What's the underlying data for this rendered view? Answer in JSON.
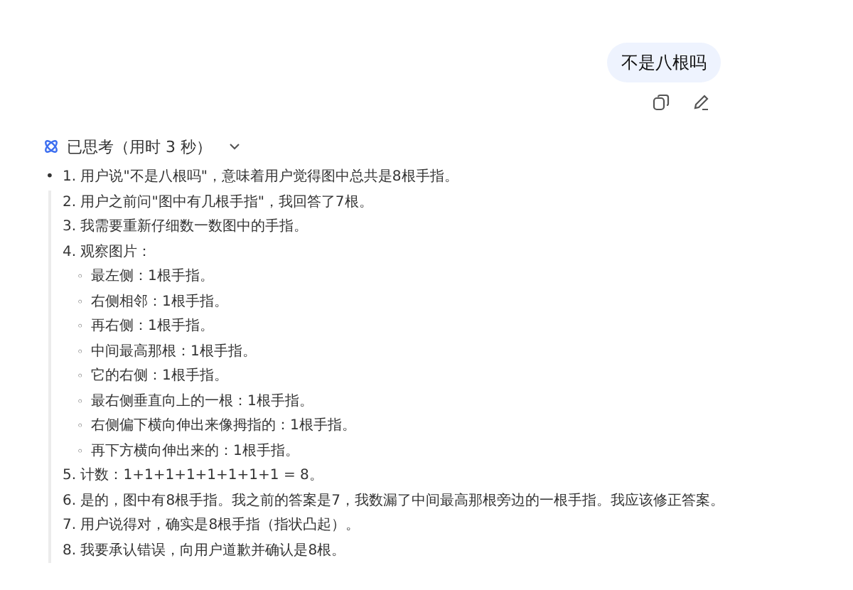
{
  "user_message": {
    "text": "不是八根吗"
  },
  "thinking": {
    "label": "已思考（用时 3 秒）",
    "expanded": true,
    "marker": "•",
    "steps": [
      {
        "text": "1. 用户说\"不是八根吗\"，意味着用户觉得图中总共是8根手指。"
      },
      {
        "text": "2. 用户之前问\"图中有几根手指\"，我回答了7根。"
      },
      {
        "text": "3. 我需要重新仔细数一数图中的手指。"
      },
      {
        "text": "4. 观察图片：",
        "children": [
          {
            "marker": "◦",
            "text": "最左侧：1根手指。"
          },
          {
            "marker": "◦",
            "text": "右侧相邻：1根手指。"
          },
          {
            "marker": "◦",
            "text": "再右侧：1根手指。"
          },
          {
            "marker": "◦",
            "text": "中间最高那根：1根手指。"
          },
          {
            "marker": "◦",
            "text": "它的右侧：1根手指。"
          },
          {
            "marker": "◦",
            "text": "最右侧垂直向上的一根：1根手指。"
          },
          {
            "marker": "◦",
            "text": "右侧偏下横向伸出来像拇指的：1根手指。"
          },
          {
            "marker": "◦",
            "text": "再下方横向伸出来的：1根手指。"
          }
        ]
      },
      {
        "text": "5. 计数：1+1+1+1+1+1+1+1 = 8。"
      },
      {
        "text": "6. 是的，图中有8根手指。我之前的答案是7，我数漏了中间最高那根旁边的一根手指。我应该修正答案。"
      },
      {
        "text": "7. 用户说得对，确实是8根手指（指状凸起）。"
      },
      {
        "text": "8. 我要承认错误，向用户道歉并确认是8根。"
      }
    ]
  }
}
